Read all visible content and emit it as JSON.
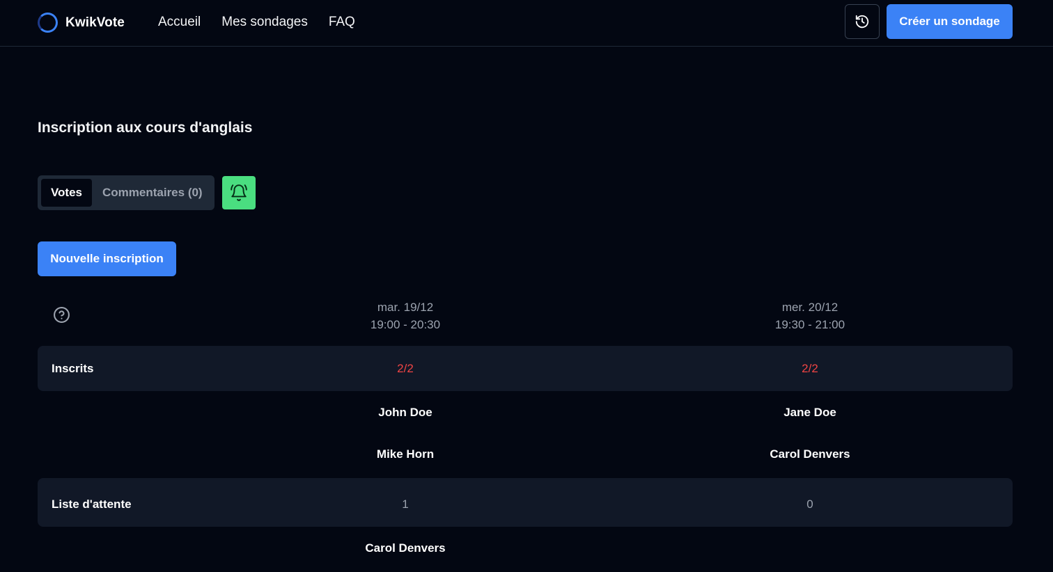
{
  "header": {
    "brand": "KwikVote",
    "nav": [
      "Accueil",
      "Mes sondages",
      "FAQ"
    ],
    "create_label": "Créer un sondage"
  },
  "poll": {
    "title": "Inscription aux cours d'anglais",
    "tabs": {
      "votes": "Votes",
      "comments": "Commentaires (0)"
    },
    "new_label": "Nouvelle inscription"
  },
  "slots": [
    {
      "day": "mar. 19/12",
      "time": "19:00 - 20:30",
      "registered": "2/2",
      "names": [
        "John Doe",
        "Mike Horn"
      ],
      "waitlist_count": "1",
      "waitlist": [
        "Carol Denvers"
      ]
    },
    {
      "day": "mer. 20/12",
      "time": "19:30 - 21:00",
      "registered": "2/2",
      "names": [
        "Jane Doe",
        "Carol Denvers"
      ],
      "waitlist_count": "0",
      "waitlist": []
    }
  ],
  "rows": {
    "registered": "Inscrits",
    "waitlist": "Liste d'attente"
  },
  "colors": {
    "accent": "#3b82f6",
    "bell": "#4ade80",
    "full": "#ef4444",
    "background": "#030712",
    "band": "#111827"
  },
  "icons": {
    "logo": "ring-logo-icon",
    "history": "history-icon",
    "bell": "bell-icon",
    "help": "help-circle-icon"
  }
}
